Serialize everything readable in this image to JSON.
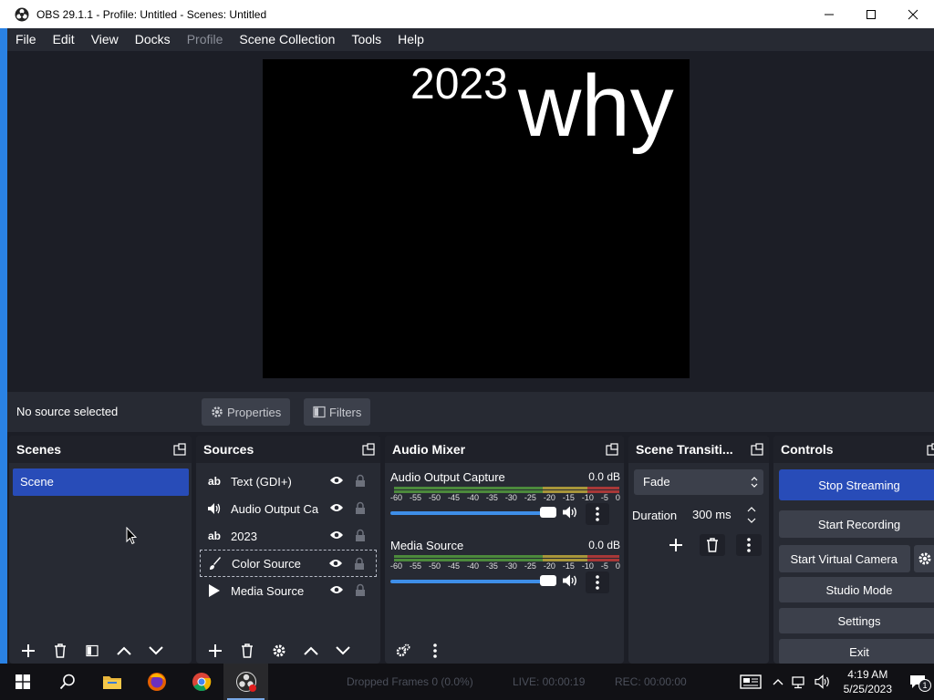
{
  "window": {
    "title": "OBS 29.1.1 - Profile: Untitled - Scenes: Untitled"
  },
  "menu": [
    "File",
    "Edit",
    "View",
    "Docks",
    "Profile",
    "Scene Collection",
    "Tools",
    "Help"
  ],
  "preview": {
    "text_2023": "2023",
    "text_why": "why"
  },
  "source_toolbar": {
    "status": "No source selected",
    "properties": "Properties",
    "filters": "Filters"
  },
  "docks": {
    "scenes": {
      "title": "Scenes",
      "items": [
        "Scene"
      ]
    },
    "sources": {
      "title": "Sources",
      "items": [
        {
          "label": "Text (GDI+)",
          "icon": "text-icon"
        },
        {
          "label": "Audio Output Ca",
          "icon": "speaker-icon"
        },
        {
          "label": "2023",
          "icon": "text-icon"
        },
        {
          "label": "Color Source",
          "icon": "paint-brush-icon"
        },
        {
          "label": "Media Source",
          "icon": "play-icon"
        }
      ]
    },
    "mixer": {
      "title": "Audio Mixer",
      "channels": [
        {
          "name": "Audio Output Capture",
          "db": "0.0 dB"
        },
        {
          "name": "Media Source",
          "db": "0.0 dB"
        }
      ],
      "ticks": [
        "-60",
        "-55",
        "-50",
        "-45",
        "-40",
        "-35",
        "-30",
        "-25",
        "-20",
        "-15",
        "-10",
        "-5",
        "0"
      ]
    },
    "transitions": {
      "title": "Scene Transiti...",
      "selected": "Fade",
      "duration_label": "Duration",
      "duration_value": "300 ms"
    },
    "controls": {
      "title": "Controls",
      "stop_streaming": "Stop Streaming",
      "start_recording": "Start Recording",
      "start_virtual_camera": "Start Virtual Camera",
      "studio_mode": "Studio Mode",
      "settings": "Settings",
      "exit": "Exit"
    }
  },
  "statusbar": {
    "dropped": "Dropped Frames 0 (0.0%)",
    "live": "LIVE: 00:00:19",
    "rec": "REC: 00:00:00"
  },
  "taskbar": {
    "time": "4:19 AM",
    "date": "5/25/2023",
    "notifications": "1"
  },
  "colors": {
    "accent_blue": "#284cb8",
    "dock_bg": "#272a33",
    "window_bg": "#1c1e26"
  }
}
